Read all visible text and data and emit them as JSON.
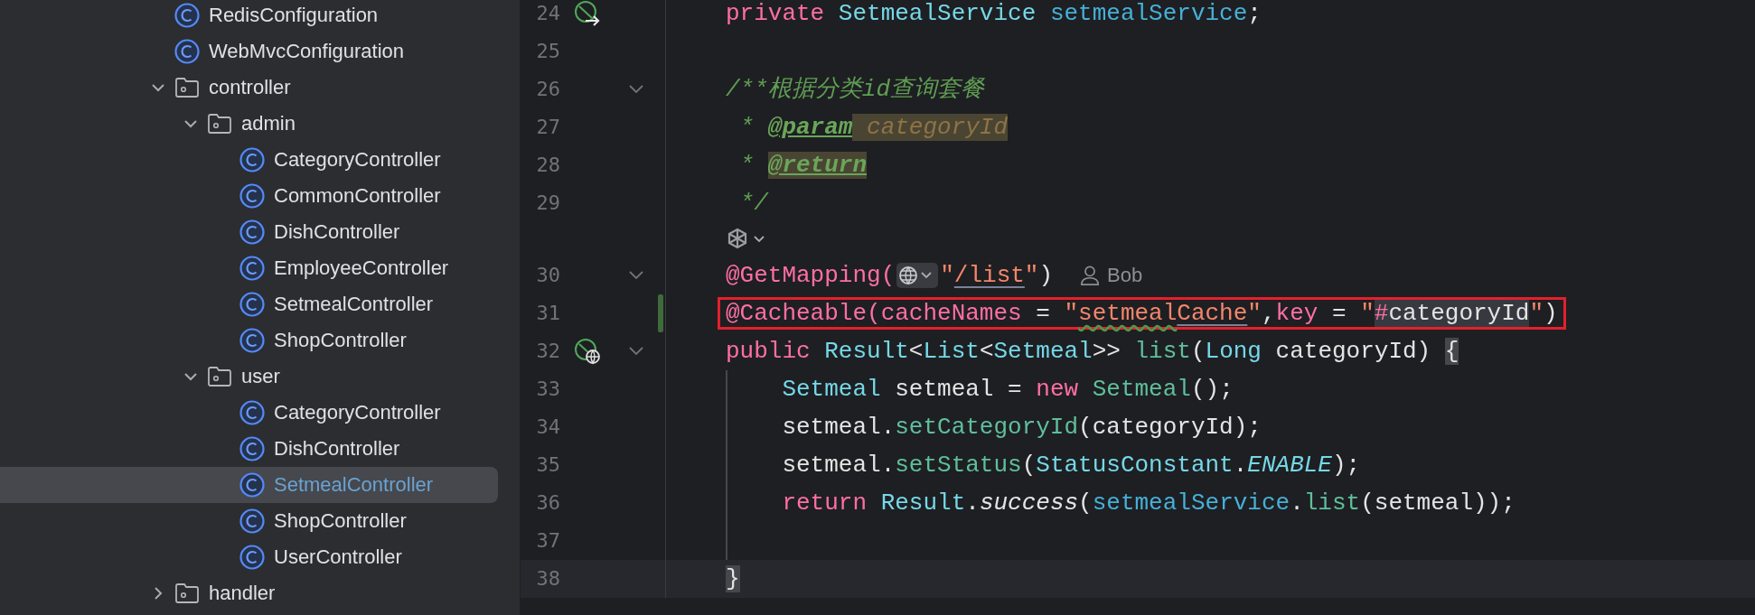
{
  "tree": [
    {
      "kind": "class",
      "name": "RedisConfiguration",
      "selected": false
    },
    {
      "kind": "class",
      "name": "WebMvcConfiguration",
      "selected": false
    },
    {
      "kind": "package",
      "name": "controller",
      "selected": false,
      "expanded": true,
      "children": [
        {
          "kind": "package",
          "name": "admin",
          "selected": false,
          "expanded": true,
          "children": [
            {
              "kind": "class",
              "name": "CategoryController",
              "selected": false
            },
            {
              "kind": "class",
              "name": "CommonController",
              "selected": false
            },
            {
              "kind": "class",
              "name": "DishController",
              "selected": false
            },
            {
              "kind": "class",
              "name": "EmployeeController",
              "selected": false
            },
            {
              "kind": "class",
              "name": "SetmealController",
              "selected": false
            },
            {
              "kind": "class",
              "name": "ShopController",
              "selected": false
            }
          ]
        },
        {
          "kind": "package",
          "name": "user",
          "selected": false,
          "expanded": true,
          "children": [
            {
              "kind": "class",
              "name": "CategoryController",
              "selected": false
            },
            {
              "kind": "class",
              "name": "DishController",
              "selected": false
            },
            {
              "kind": "class",
              "name": "SetmealController",
              "selected": true
            },
            {
              "kind": "class",
              "name": "ShopController",
              "selected": false
            },
            {
              "kind": "class",
              "name": "UserController",
              "selected": false
            }
          ]
        }
      ]
    },
    {
      "kind": "package",
      "name": "handler",
      "selected": false,
      "expanded": false
    }
  ],
  "code": [
    {
      "kind": "code",
      "number": "24",
      "gutter": {
        "kind": "bean-arrow"
      },
      "tokens": [
        {
          "kind": "kw",
          "text": "private "
        },
        {
          "kind": "type",
          "text": "SetmealService "
        },
        {
          "kind": "field",
          "text": "setmealService"
        },
        {
          "kind": "plain",
          "text": ";"
        }
      ]
    },
    {
      "kind": "code",
      "number": "25"
    },
    {
      "kind": "code",
      "number": "26",
      "foldable": true,
      "tokens": [
        {
          "kind": "comment",
          "text": "/**根据分类id查询套餐"
        }
      ]
    },
    {
      "kind": "code",
      "number": "27",
      "tokens": [
        {
          "kind": "comment",
          "text": " * "
        },
        {
          "kind": "doctag",
          "text": "@param"
        },
        {
          "kind": "param",
          "text": " categoryId"
        }
      ]
    },
    {
      "kind": "code",
      "number": "28",
      "tokens": [
        {
          "kind": "comment",
          "text": " * "
        },
        {
          "kind": "doctag_hl",
          "text": "@return"
        }
      ]
    },
    {
      "kind": "code",
      "number": "29",
      "tokens": [
        {
          "kind": "comment",
          "text": " */"
        }
      ]
    },
    {
      "kind": "inlay"
    },
    {
      "kind": "code",
      "number": "30",
      "foldable": true,
      "author": "Bob",
      "tokens": [
        {
          "kind": "ann",
          "text": "@GetMapping("
        },
        {
          "kind": "globe"
        },
        {
          "kind": "str",
          "text": "\""
        },
        {
          "kind": "str_u",
          "text": "/list"
        },
        {
          "kind": "str",
          "text": "\""
        },
        {
          "kind": "plain",
          "text": ")"
        }
      ]
    },
    {
      "kind": "code",
      "number": "31",
      "boxed": true,
      "modified": true,
      "tokens": [
        {
          "kind": "ann",
          "text": "@Cacheable("
        },
        {
          "kind": "ann",
          "text": "cacheNames"
        },
        {
          "kind": "plain",
          "text": " = "
        },
        {
          "kind": "str",
          "text": "\""
        },
        {
          "kind": "str_typo",
          "text": "setmeal"
        },
        {
          "kind": "str_u",
          "text": "Cache"
        },
        {
          "kind": "str",
          "text": "\""
        },
        {
          "kind": "plain",
          "text": ","
        },
        {
          "kind": "ann",
          "text": "key"
        },
        {
          "kind": "plain",
          "text": " = "
        },
        {
          "kind": "str",
          "text": "\""
        },
        {
          "kind": "ann_hl",
          "text": "#"
        },
        {
          "kind": "hl",
          "text": "categoryId"
        },
        {
          "kind": "str",
          "text": "\""
        },
        {
          "kind": "plain",
          "text": ")"
        }
      ]
    },
    {
      "kind": "code",
      "number": "32",
      "gutter": {
        "kind": "bean-globe"
      },
      "foldable": true,
      "tokens": [
        {
          "kind": "kw",
          "text": "public "
        },
        {
          "kind": "type",
          "text": "Result"
        },
        {
          "kind": "plain",
          "text": "<"
        },
        {
          "kind": "type",
          "text": "List"
        },
        {
          "kind": "plain",
          "text": "<"
        },
        {
          "kind": "type",
          "text": "Setmeal"
        },
        {
          "kind": "plain",
          "text": ">> "
        },
        {
          "kind": "method",
          "text": "list"
        },
        {
          "kind": "plain",
          "text": "("
        },
        {
          "kind": "type",
          "text": "Long"
        },
        {
          "kind": "plain",
          "text": " categoryId) "
        },
        {
          "kind": "brace",
          "text": "{"
        }
      ]
    },
    {
      "kind": "code",
      "number": "33",
      "indent_guide": true,
      "tokens": [
        {
          "kind": "type",
          "text": "    Setmeal"
        },
        {
          "kind": "plain",
          "text": " setmeal = "
        },
        {
          "kind": "kw",
          "text": "new "
        },
        {
          "kind": "method",
          "text": "Setmeal"
        },
        {
          "kind": "plain",
          "text": "();"
        }
      ]
    },
    {
      "kind": "code",
      "number": "34",
      "indent_guide": true,
      "tokens": [
        {
          "kind": "plain",
          "text": "    setmeal."
        },
        {
          "kind": "method",
          "text": "setCategoryId"
        },
        {
          "kind": "plain",
          "text": "(categoryId);"
        }
      ]
    },
    {
      "kind": "code",
      "number": "35",
      "indent_guide": true,
      "tokens": [
        {
          "kind": "plain",
          "text": "    setmeal."
        },
        {
          "kind": "method",
          "text": "setStatus"
        },
        {
          "kind": "plain",
          "text": "("
        },
        {
          "kind": "type",
          "text": "StatusConstant"
        },
        {
          "kind": "plain",
          "text": "."
        },
        {
          "kind": "static",
          "text": "ENABLE"
        },
        {
          "kind": "plain",
          "text": ");"
        }
      ]
    },
    {
      "kind": "code",
      "number": "36",
      "indent_guide": true,
      "tokens": [
        {
          "kind": "kw",
          "text": "    return "
        },
        {
          "kind": "type",
          "text": "Result"
        },
        {
          "kind": "plain",
          "text": "."
        },
        {
          "kind": "italic",
          "text": "success"
        },
        {
          "kind": "plain",
          "text": "("
        },
        {
          "kind": "field",
          "text": "setmealService"
        },
        {
          "kind": "plain",
          "text": "."
        },
        {
          "kind": "method",
          "text": "list"
        },
        {
          "kind": "plain",
          "text": "(setmeal));"
        }
      ]
    },
    {
      "kind": "code",
      "number": "37",
      "indent_guide": true
    },
    {
      "kind": "code",
      "number": "38",
      "current": true,
      "tokens": [
        {
          "kind": "brace",
          "text": "}"
        }
      ]
    }
  ]
}
